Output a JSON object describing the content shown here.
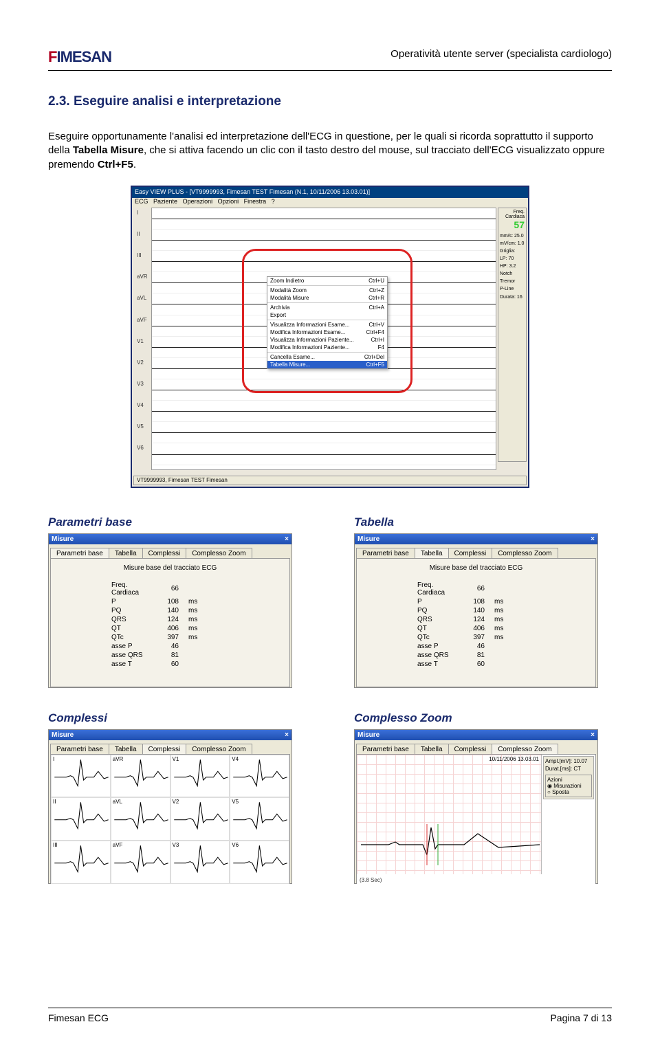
{
  "header": {
    "logo_f": "F",
    "logo_rest": "IMESAN",
    "title": "Operatività utente server (specialista cardiologo)"
  },
  "heading": "2.3. Eseguire analisi e interpretazione",
  "body_pre": "Eseguire opportunamente l'analisi ed interpretazione dell'ECG in questione, per le quali si ricorda soprattutto il supporto della ",
  "body_bold": "Tabella Misure",
  "body_post": ", che si attiva facendo un clic con il tasto destro del mouse, sul tracciato dell'ECG visualizzato oppure premendo ",
  "body_bold2": "Ctrl+F5",
  "body_end": ".",
  "ecg_window": {
    "title": "Easy VIEW PLUS - [VT9999993, Fimesan TEST Fimesan (N.1, 10/11/2006 13.03.01)]",
    "menu": [
      "ECG",
      "Paziente",
      "Operazioni",
      "Opzioni",
      "Finestra",
      "?"
    ],
    "leads": [
      "I",
      "II",
      "III",
      "aVR",
      "aVL",
      "aVF",
      "V1",
      "V2",
      "V3",
      "V4",
      "V5",
      "V6"
    ],
    "status": "VT9999993, Fimesan TEST Fimesan",
    "hr_label": "Freq. Cardiaca",
    "hr_value": "57",
    "side": {
      "mms_label": "mm/s:",
      "mms": "25.0",
      "mvcm_label": "mV/cm:",
      "mvcm": "1.0",
      "griglia": "Griglia:",
      "lp_label": "LP:",
      "lp": "70",
      "hp_label": "HP:",
      "hp": "3.2",
      "notch": "Notch",
      "tremor": "Tremor",
      "pline": "P-Line",
      "durata_label": "Durata:",
      "durata": "16"
    },
    "ctx_items": [
      {
        "label": "Zoom Indietro",
        "short": "Ctrl+U"
      },
      {
        "sep": true
      },
      {
        "label": "Modalità Zoom",
        "short": "Ctrl+Z"
      },
      {
        "label": "Modalità Misure",
        "short": "Ctrl+R"
      },
      {
        "sep": true
      },
      {
        "label": "Archivia",
        "short": "Ctrl+A"
      },
      {
        "label": "Export",
        "short": ""
      },
      {
        "sep": true
      },
      {
        "label": "Visualizza Informazioni Esame...",
        "short": "Ctrl+V"
      },
      {
        "label": "Modifica Informazioni Esame...",
        "short": "Ctrl+F4"
      },
      {
        "label": "Visualizza Informazioni Paziente...",
        "short": "Ctrl+I"
      },
      {
        "label": "Modifica Informazioni Paziente...",
        "short": "F4"
      },
      {
        "sep": true
      },
      {
        "label": "Cancella Esame...",
        "short": "Ctrl+Del"
      },
      {
        "label": "Tabella Misure...",
        "short": "Ctrl+F5",
        "sel": true
      }
    ]
  },
  "subheads": {
    "params": "Parametri base",
    "tabella": "Tabella",
    "compl": "Complessi",
    "czoom": "Complesso Zoom"
  },
  "misure_window": {
    "title": "Misure",
    "close": "×",
    "tabs": [
      "Parametri base",
      "Tabella",
      "Complessi",
      "Complesso Zoom"
    ],
    "heading": "Misure base del tracciato ECG",
    "rows": [
      {
        "label": "Freq. Cardiaca",
        "val": "66",
        "unit": ""
      },
      {
        "label": "P",
        "val": "108",
        "unit": "ms"
      },
      {
        "label": "PQ",
        "val": "140",
        "unit": "ms"
      },
      {
        "label": "QRS",
        "val": "124",
        "unit": "ms"
      },
      {
        "label": "QT",
        "val": "406",
        "unit": "ms"
      },
      {
        "label": "QTc",
        "val": "397",
        "unit": "ms"
      },
      {
        "label": "asse P",
        "val": "46",
        "unit": ""
      },
      {
        "label": "asse QRS",
        "val": "81",
        "unit": ""
      },
      {
        "label": "asse T",
        "val": "60",
        "unit": ""
      }
    ]
  },
  "complessi": {
    "leads": [
      "I",
      "aVR",
      "V1",
      "V4",
      "II",
      "aVL",
      "V2",
      "V5",
      "III",
      "aVF",
      "V3",
      "V6"
    ]
  },
  "czoom": {
    "timestamp": "10/11/2006 13.03.01",
    "ampl_label": "Ampl.[mV]:",
    "ampl": "10.07",
    "durat_label": "Durat.[ms]:",
    "durat": "CT",
    "azioni": "Azioni",
    "misurazioni": "Misurazioni",
    "sposta": "Sposta",
    "bottom": "(3.8 Sec)"
  },
  "footer": {
    "left": "Fimesan ECG",
    "right": "Pagina 7 di 13"
  }
}
